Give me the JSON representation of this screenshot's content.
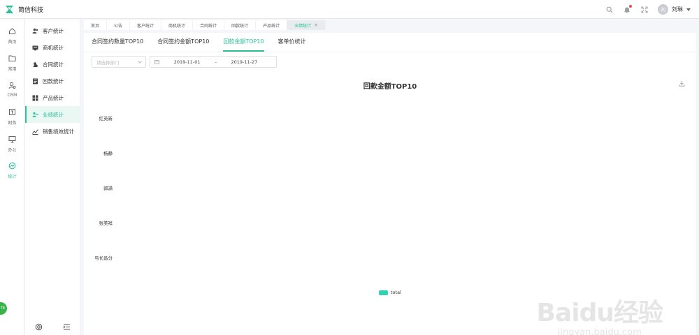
{
  "header": {
    "app_title": "简信科技",
    "user_initial": "刘",
    "user_name": "刘琳"
  },
  "rail": {
    "items": [
      {
        "label": "首页",
        "icon": "home-icon"
      },
      {
        "label": "常用",
        "icon": "folder-icon"
      },
      {
        "label": "CRM",
        "icon": "crm-icon"
      },
      {
        "label": "财务",
        "icon": "finance-icon"
      },
      {
        "label": "办公",
        "icon": "monitor-icon"
      },
      {
        "label": "统计",
        "icon": "stats-icon"
      }
    ],
    "fab_label": "78"
  },
  "subnav": {
    "items": [
      {
        "label": "客户统计",
        "icon": "user-icon"
      },
      {
        "label": "商机统计",
        "icon": "opportunity-icon"
      },
      {
        "label": "合同统计",
        "icon": "contract-icon"
      },
      {
        "label": "回款统计",
        "icon": "payment-icon"
      },
      {
        "label": "产品统计",
        "icon": "grid-icon"
      },
      {
        "label": "业绩统计",
        "icon": "performance-icon"
      },
      {
        "label": "销售绩效统计",
        "icon": "trend-icon"
      }
    ],
    "active_index": 5
  },
  "page_tabs": [
    {
      "label": "首页"
    },
    {
      "label": "公告"
    },
    {
      "label": "客户统计"
    },
    {
      "label": "商机统计"
    },
    {
      "label": "合同统计"
    },
    {
      "label": "回款统计"
    },
    {
      "label": "产品统计"
    },
    {
      "label": "业绩统计",
      "closable": true
    }
  ],
  "sub_tabs": [
    {
      "label": "合同签约数量TOP10"
    },
    {
      "label": "合同签约金额TOP10"
    },
    {
      "label": "回款金额TOP10"
    },
    {
      "label": "客单价统计"
    }
  ],
  "filters": {
    "department_placeholder": "请选择部门",
    "date_start": "2019-11-01",
    "date_sep": "-",
    "date_end": "2019-11-27"
  },
  "chart_data": {
    "type": "bar",
    "orientation": "horizontal",
    "title": "回款金额TOP10",
    "categories": [
      "红英新",
      "杨静",
      "郭满",
      "张美祥",
      "弓长昌分"
    ],
    "series": [
      {
        "name": "total",
        "color": "#2fd3b2",
        "values": [
          0,
          0,
          0,
          0,
          0
        ]
      }
    ],
    "legend": "bottom-center"
  },
  "watermark": {
    "brand": "Baidu经验",
    "url": "jingyan.baidu.com"
  },
  "colors": {
    "accent": "#2bbf9a",
    "series": "#2fd3b2"
  }
}
